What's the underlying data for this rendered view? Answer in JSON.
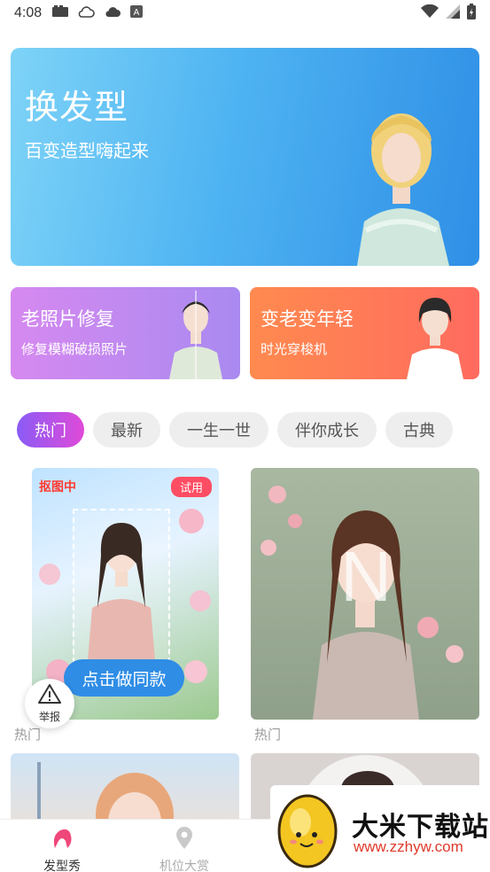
{
  "status_bar": {
    "time": "4:08"
  },
  "hero": {
    "title": "换发型",
    "subtitle": "百变造型嗨起来"
  },
  "cards": [
    {
      "title": "老照片修复",
      "subtitle": "修复模糊破损照片"
    },
    {
      "title": "变老变年轻",
      "subtitle": "时光穿梭机"
    }
  ],
  "tabs": [
    {
      "label": "热门",
      "active": true
    },
    {
      "label": "最新",
      "active": false
    },
    {
      "label": "一生一世",
      "active": false
    },
    {
      "label": "伴你成长",
      "active": false
    },
    {
      "label": "古典",
      "active": false
    }
  ],
  "tiles": [
    {
      "cutout_label": "抠图中",
      "trial_badge": "试用",
      "cta_label": "点击做同款",
      "caption": "热门"
    },
    {
      "caption": "热门"
    }
  ],
  "report": {
    "label": "举报",
    "icon": "warning-triangle-icon"
  },
  "bottom_nav": [
    {
      "label": "发型秀",
      "icon": "hair-icon",
      "active": true
    },
    {
      "label": "机位大赏",
      "icon": "location-pin-icon",
      "active": false
    }
  ],
  "watermark": {
    "title": "大米下载站",
    "url": "www.zzhyw.com"
  },
  "colors": {
    "accent": "#2f8de6",
    "tab_active_start": "#8a5cf6",
    "tab_active_end": "#e04ad8",
    "badge_red": "#ff4d63"
  }
}
